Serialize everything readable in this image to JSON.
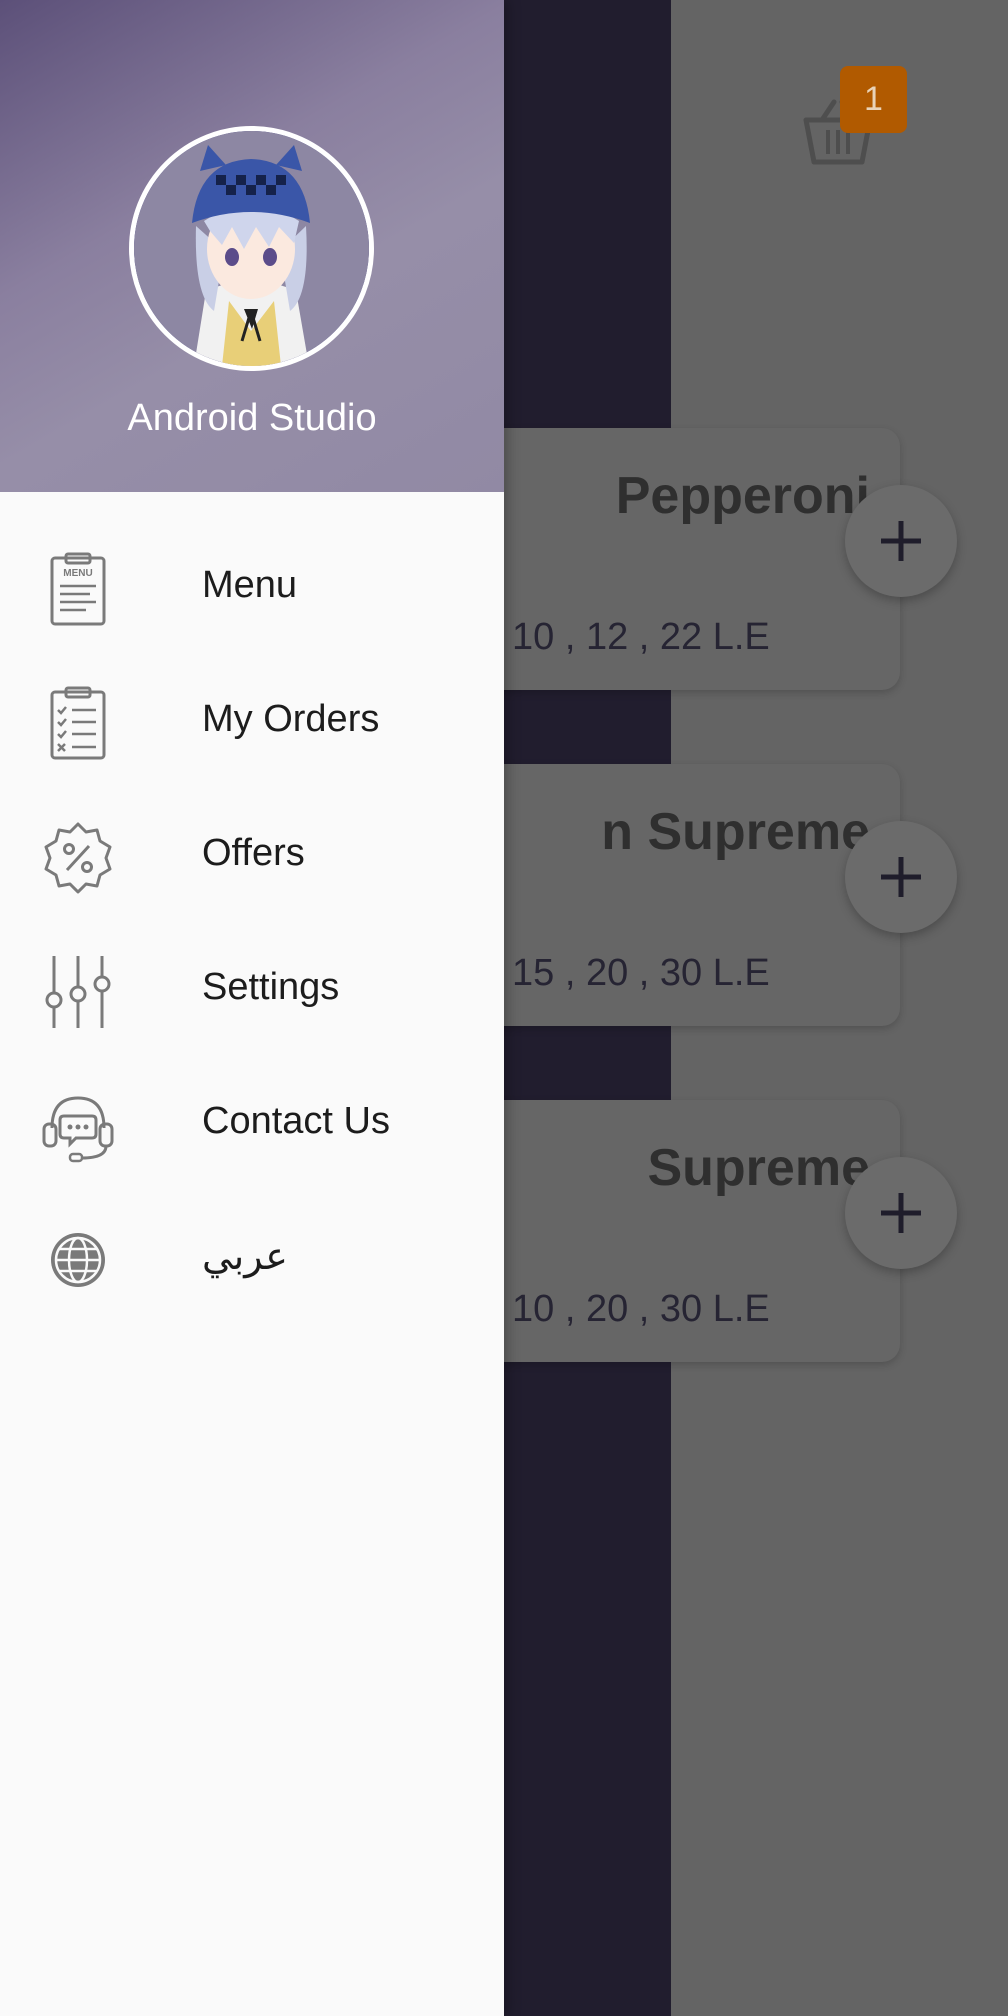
{
  "cart": {
    "icon": "basket-icon",
    "badge": "1"
  },
  "products": [
    {
      "title": "Pepperoni",
      "price": "10 , 12 , 22 L.E",
      "add_icon": "plus-icon"
    },
    {
      "title": "n Supreme",
      "price": "15 , 20 , 30 L.E",
      "add_icon": "plus-icon"
    },
    {
      "title": "Supreme",
      "price": "10 , 20 , 30 L.E",
      "add_icon": "plus-icon"
    }
  ],
  "drawer": {
    "user_name": "Android Studio",
    "items": [
      {
        "label": "Menu",
        "icon": "menu-clipboard-icon"
      },
      {
        "label": "My Orders",
        "icon": "orders-clipboard-icon"
      },
      {
        "label": "Offers",
        "icon": "percent-badge-icon"
      },
      {
        "label": "Settings",
        "icon": "sliders-icon"
      },
      {
        "label": "Contact Us",
        "icon": "headset-icon"
      },
      {
        "label": "عربي",
        "icon": "globe-icon"
      }
    ]
  },
  "colors": {
    "header_gradient_start": "#5c5079",
    "header_gradient_end": "#968ea8",
    "cart_badge": "#b15a00",
    "scrim": "#646464",
    "icon_gray": "#7a7a7a"
  }
}
